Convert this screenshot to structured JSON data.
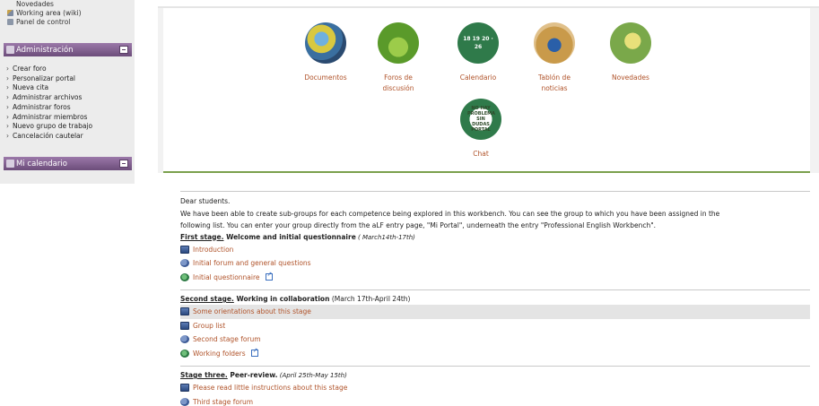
{
  "sidebar": {
    "top_links": [
      {
        "label": "Novedades",
        "icon": "news-icon"
      },
      {
        "label": "Working area (wiki)",
        "icon": "pencil-icon"
      },
      {
        "label": "Panel de control",
        "icon": "control-panel-icon"
      }
    ],
    "admin_header": "Administración",
    "admin_items": [
      "Crear foro",
      "Personalizar portal",
      "Nueva cita",
      "Administrar archivos",
      "Administrar foros",
      "Administrar miembros",
      "Nuevo grupo de trabajo",
      "Cancelación cautelar"
    ],
    "calendar_header": "Mi calendario"
  },
  "tools": [
    {
      "label_line1": "Documentos",
      "label_line2": "",
      "icon": "documents-icon"
    },
    {
      "label_line1": "Foros de",
      "label_line2": "discusión",
      "icon": "forums-icon"
    },
    {
      "label_line1": "Calendario",
      "label_line2": "",
      "icon": "calendar-icon",
      "circle_text": "18 19 20 · 26"
    },
    {
      "label_line1": "Tablón de",
      "label_line2": "noticias",
      "icon": "bulletin-board-icon"
    },
    {
      "label_line1": "Novedades",
      "label_line2": "",
      "icon": "news-icon"
    },
    {
      "label_line1": "Chat",
      "label_line2": "",
      "icon": "chat-icon",
      "circle_text": "NO HAY PROBLEMA SIN DUDAS PORTAL"
    }
  ],
  "content": {
    "greeting": "Dear students.",
    "intro_line1": "We have been able to create sub-groups for each competence being explored in this workbench. You can see the group to which you have been assigned in the",
    "intro_line2": "following list. You can enter your group directly from the aLF entry page, \"Mi Portal\", underneath the entry \"Professional English Workbench\".",
    "stages": [
      {
        "title_underlined": "First stage.",
        "title_bold": " Welcome and initial questionnaire",
        "title_dates": " ( March14th-17th)",
        "dates_italic": true,
        "resources": [
          {
            "label": "Introduction",
            "icon": "page-icon"
          },
          {
            "label": "Initial forum and general questions",
            "icon": "forum-icon"
          },
          {
            "label": "Initial questionnaire",
            "icon": "folder-icon",
            "external": true
          }
        ]
      },
      {
        "title_underlined": "Second stage.",
        "title_bold": " Working in collaboration",
        "title_dates": " (March 17th-April 24th)",
        "dates_italic": false,
        "resources": [
          {
            "label": "Some orientations about this stage",
            "icon": "page-icon",
            "highlighted": true
          },
          {
            "label": "Group list",
            "icon": "page-icon"
          },
          {
            "label": "Second stage forum",
            "icon": "forum-icon"
          },
          {
            "label": "Working folders",
            "icon": "folder-icon",
            "external": true
          }
        ]
      },
      {
        "title_underlined": "Stage three.",
        "title_bold": " Peer-review.",
        "title_dates": " (April 25th-May 15th)",
        "dates_italic": true,
        "resources": [
          {
            "label": "Please read little instructions about this stage",
            "icon": "page-icon"
          },
          {
            "label": "Third stage forum",
            "icon": "forum-icon"
          }
        ]
      }
    ]
  },
  "colors": {
    "link": "#b0532a",
    "sidebar_header": "#7a5a88",
    "panel_divider": "#7aa04d"
  }
}
